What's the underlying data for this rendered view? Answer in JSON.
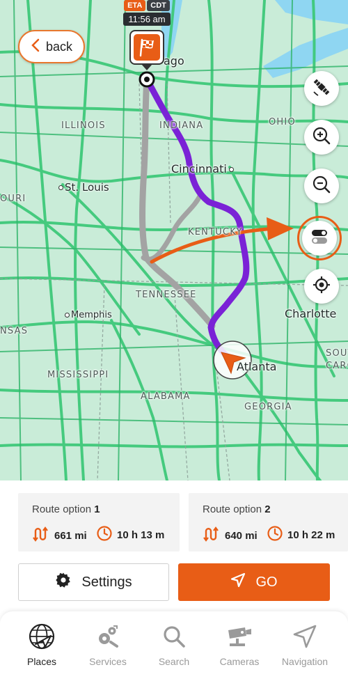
{
  "map": {
    "back_label": "back",
    "eta_tag": "ETA",
    "tz_tag": "CDT",
    "eta_time": "11:56 am",
    "labels": {
      "illinois": "ILLINOIS",
      "indiana": "INDIANA",
      "ohio": "OHIO",
      "kentucky": "KENTUCKY",
      "tennessee": "TENNESSEE",
      "mississippi": "MISSISSIPPI",
      "alabama": "ALABAMA",
      "georgia": "GEORGIA",
      "missouri_partial": "OURI",
      "arkansas_partial": "NSAS",
      "south_carolina_partial_1": "SOUT",
      "south_carolina_partial_2": "CARO",
      "chicago_partial": "ago",
      "cincinnati": "Cincinnati",
      "st_louis": "St. Louis",
      "memphis": "Memphis",
      "charlotte": "Charlotte",
      "atlanta": "Atlanta"
    },
    "icons": {
      "satellite": "satellite-icon",
      "zoom_in": "zoom-in-icon",
      "zoom_out": "zoom-out-icon",
      "toggle": "toggle-icon",
      "locate": "crosshair-icon",
      "destination": "checkered-flag-icon",
      "origin": "navigation-arrow-icon"
    }
  },
  "routes": [
    {
      "label": "Route option",
      "number": "1",
      "distance": "661 mi",
      "duration": "10 h 13 m"
    },
    {
      "label": "Route option",
      "number": "2",
      "distance": "640 mi",
      "duration": "10 h 22 m"
    }
  ],
  "actions": {
    "settings_label": "Settings",
    "go_label": "GO"
  },
  "nav": [
    {
      "label": "Places",
      "icon": "globe-plane-icon",
      "active": true
    },
    {
      "label": "Services",
      "icon": "gears-icon",
      "active": false
    },
    {
      "label": "Search",
      "icon": "search-icon",
      "active": false
    },
    {
      "label": "Cameras",
      "icon": "camera-icon",
      "active": false
    },
    {
      "label": "Navigation",
      "icon": "navigation-icon",
      "active": false
    }
  ],
  "colors": {
    "accent": "#e85d16",
    "route_primary": "#7a22d6",
    "route_alternate": "#9a9a9a",
    "map_land": "#c9ecd8",
    "map_roads": "#3ec97a",
    "water": "#7fd3f0"
  }
}
